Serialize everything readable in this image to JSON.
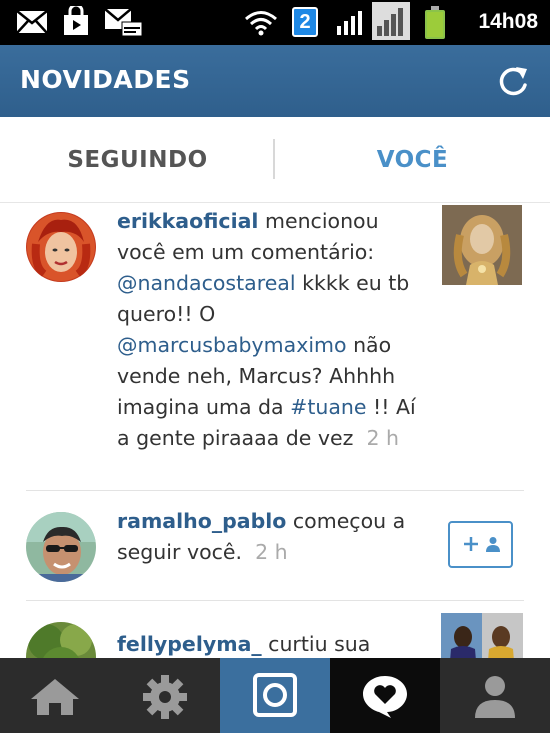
{
  "status_bar": {
    "time": "14h08",
    "network_badge": "2",
    "icons": [
      "mail-icon",
      "bag-icon",
      "mail-alert-icon",
      "wifi-icon",
      "network-badge-icon",
      "signal-icon",
      "signal-icon",
      "battery-icon"
    ]
  },
  "header": {
    "title": "NOVIDADES",
    "refresh_icon": "refresh-icon"
  },
  "tabs": [
    {
      "label": "SEGUINDO",
      "active": false
    },
    {
      "label": "VOCÊ",
      "active": true
    }
  ],
  "feed": [
    {
      "username": "erikkaoficial",
      "text_before": " mencionou você em um comentário: ",
      "mention1": "@nandacostareal",
      "text_mid": " kkkk eu tb quero!! O ",
      "mention2": "@marcusbabymaximo",
      "text_mid2": " não vende neh, Marcus? Ahhhh imagina uma da ",
      "hashtag": "#tuane",
      "text_end": " !! Aí a gente piraaaa de vez",
      "time": "2 h"
    },
    {
      "username": "ramalho_pablo",
      "text": " começou a seguir você.",
      "time": "2 h",
      "action_icons": [
        "plus-icon",
        "person-icon"
      ]
    },
    {
      "username": "fellypelyma_",
      "text": " curtiu sua"
    }
  ],
  "bottom_nav": [
    "home-icon",
    "explore-icon",
    "camera-icon",
    "activity-icon",
    "profile-icon"
  ],
  "colors": {
    "action_bar": "#336699",
    "link": "#2e5e8c",
    "active_tab": "#4a90c8",
    "nav_bg": "#2c2c2c",
    "camera_bg": "#3b6f9e"
  }
}
